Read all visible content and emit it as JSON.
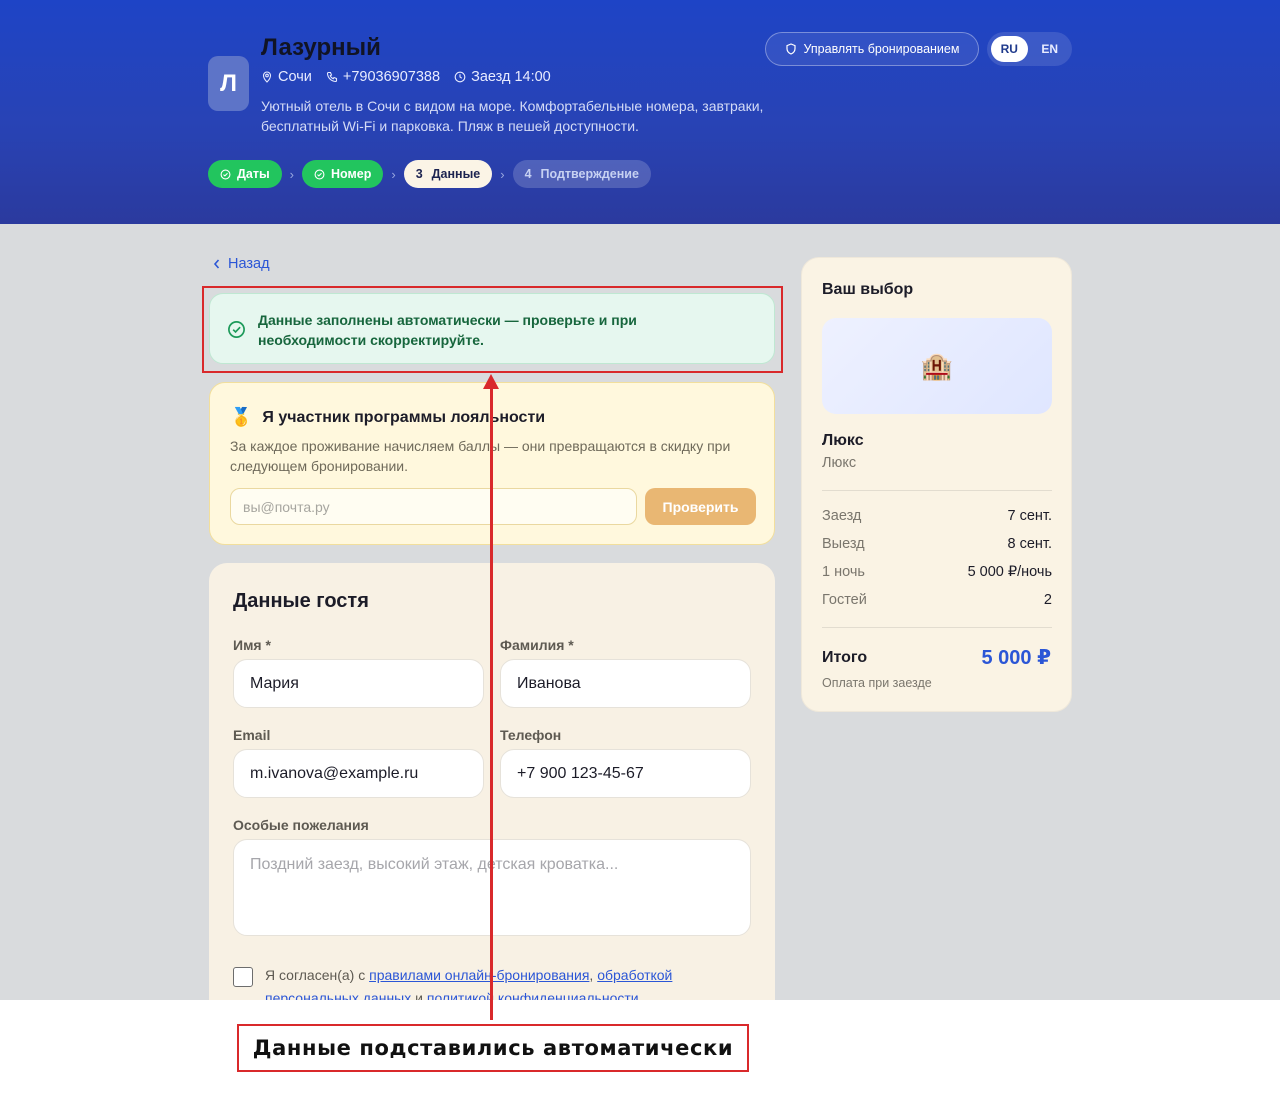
{
  "hotel": {
    "logo_letter": "Л",
    "name": "Лазурный",
    "city": "Сочи",
    "phone": "+79036907388",
    "checkin": "Заезд 14:00",
    "description": "Уютный отель в Сочи с видом на море. Комфортабельные номера, завтраки, бесплатный Wi-Fi и парковка. Пляж в пешей доступности."
  },
  "header": {
    "manage_label": "Управлять бронированием",
    "lang_ru": "RU",
    "lang_en": "EN",
    "active_lang": "RU"
  },
  "steps": [
    {
      "label": "Даты",
      "state": "done"
    },
    {
      "label": "Номер",
      "state": "done"
    },
    {
      "num": "3",
      "label": "Данные",
      "state": "active"
    },
    {
      "num": "4",
      "label": "Подтверждение",
      "state": "todo"
    }
  ],
  "back_label": "Назад",
  "auto_note": "Данные заполнены автоматически — проверьте и при необходимости скорректируйте.",
  "loyalty": {
    "title": "Я участник программы лояльности",
    "subtitle": "За каждое проживание начисляем баллы — они превращаются в скидку при следующем бронировании.",
    "placeholder": "вы@почта.ру",
    "button": "Проверить"
  },
  "guest": {
    "title": "Данные гостя",
    "first_name_label": "Имя *",
    "first_name": "Мария",
    "last_name_label": "Фамилия *",
    "last_name": "Иванова",
    "email_label": "Email",
    "email": "m.ivanova@example.ru",
    "phone_label": "Телефон",
    "phone": "+7 900 123-45-67",
    "wishes_label": "Особые пожелания",
    "wishes_placeholder": "Поздний заезд, высокий этаж, детская кроватка...",
    "consent_prefix": "Я согласен(а) с ",
    "consent_link1": "правилами онлайн-бронирования",
    "consent_sep": ", ",
    "consent_link2": "обработкой персональных данных",
    "consent_and": " и ",
    "consent_link3": "политикой конфиденциальности"
  },
  "summary": {
    "title": "Ваш выбор",
    "room": "Люкс",
    "room_sub": "Люкс",
    "checkin_k": "Заезд",
    "checkin_v": "7 сент.",
    "checkout_k": "Выезд",
    "checkout_v": "8 сент.",
    "nights_k": "1 ночь",
    "nights_v": "5 000 ₽/ночь",
    "guests_k": "Гостей",
    "guests_v": "2",
    "total_k": "Итого",
    "total_v": "5 000 ₽",
    "pay_note": "Оплата при заезде"
  },
  "annotation": {
    "callout": "Данные подставились автоматически"
  },
  "colors": {
    "brand": "#1e44c6",
    "success": "#22c55e",
    "accent": "#2b56d6",
    "annotation": "#d9292b"
  }
}
